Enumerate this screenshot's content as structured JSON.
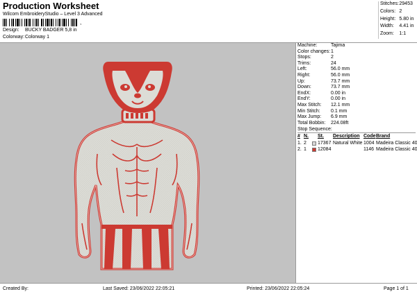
{
  "header": {
    "title": "Production Worksheet",
    "subtitle": "Wilcom EmbroideryStudio – Level 3 Advanced",
    "barcode_suffix": ",",
    "design_label": "Design:",
    "design_value": "BUCKY BADGER 5,8 in",
    "colorway_label": "Colorway:",
    "colorway_value": "Colorway 1"
  },
  "stats": [
    {
      "label": "Stitches:",
      "value": "29453"
    },
    {
      "label": "Colors:",
      "value": "2"
    },
    {
      "label": "Height:",
      "value": "5.80 in"
    },
    {
      "label": "Width:",
      "value": "4.41 in"
    },
    {
      "label": "Zoom:",
      "value": "1:1"
    }
  ],
  "info": [
    {
      "label": "Machine:",
      "value": "Tajima"
    },
    {
      "label": "Color changes:",
      "value": "1"
    },
    {
      "label": "Stops:",
      "value": "2"
    },
    {
      "label": "Trims:",
      "value": "24"
    },
    {
      "label": "Left:",
      "value": "56.0 mm"
    },
    {
      "label": "Right:",
      "value": "56.0 mm"
    },
    {
      "label": "Up:",
      "value": "73.7 mm"
    },
    {
      "label": "Down:",
      "value": "73.7 mm"
    },
    {
      "label": "EndX:",
      "value": "0.00 in"
    },
    {
      "label": "EndY:",
      "value": "0.00 in"
    },
    {
      "label": "Max Stitch:",
      "value": "12.1 mm"
    },
    {
      "label": "Min Stitch:",
      "value": "0.1 mm"
    },
    {
      "label": "Max Jump:",
      "value": "6.9 mm"
    },
    {
      "label": "Total Bobbin:",
      "value": "224.08ft"
    }
  ],
  "stop_sequence": {
    "title": "Stop Sequence:",
    "headers": {
      "num": "#",
      "n": "N.",
      "st": "St.",
      "description": "Description",
      "code": "Code",
      "brand": "Brand"
    },
    "rows": [
      {
        "num": "1.",
        "n": "2",
        "color": "#d8d8d8",
        "st": "17367",
        "description": "Natural White",
        "code": "1004",
        "brand": "Madeira Classic 40"
      },
      {
        "num": "2.",
        "n": "1",
        "color": "#cc3a32",
        "st": "12084",
        "description": "",
        "code": "1146",
        "brand": "Madeira Classic 40"
      }
    ]
  },
  "footer": {
    "created_by": "Created By:",
    "last_saved": "Last Saved: 23/06/2022 22:05:21",
    "printed": "Printed: 23/06/2022 22:05:24",
    "page": "Page 1 of 1"
  },
  "colors": {
    "design_bg": "#c2c2c2",
    "thread_white": "#dcdcd6",
    "thread_red": "#cc3a32"
  }
}
